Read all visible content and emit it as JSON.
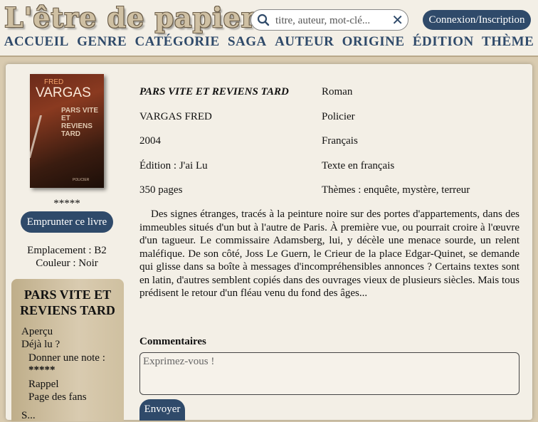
{
  "header": {
    "logo_text": "L'être de papier",
    "search": {
      "placeholder": "titre, auteur, mot-clé..."
    },
    "login_label": "Connexion/Inscription",
    "nav": [
      "ACCUEIL",
      "GENRE",
      "CATÉGORIE",
      "SAGA",
      "AUTEUR",
      "ORIGINE",
      "ÉDITION",
      "THÈME"
    ]
  },
  "book": {
    "cover": {
      "author": "FRED",
      "author_last": "VARGAS",
      "title_lines": "PARS VITE ET REVIENS TARD",
      "publisher": "POLICIER"
    },
    "rating": "*****",
    "borrow_label": "Emprunter ce livre",
    "location": "Emplacement : B2",
    "color": "Couleur : Noir",
    "title": "PARS VITE ET REVIENS TARD",
    "author": "VARGAS FRED",
    "year": "2004",
    "edition": "Édition : J'ai Lu",
    "pages": "350 pages",
    "genre": "Roman",
    "category": "Policier",
    "origin": "Français",
    "language": "Texte en français",
    "themes": "Thèmes : enquête, mystère, terreur",
    "description": "Des signes étranges, tracés à la peinture noire sur des portes d'appartements, dans des immeubles situés d'un but à l'autre de Paris. À première vue, ou pourrait croire à l'œuvre d'un tagueur. Le commissaire Adamsberg, lui, y décèle une menace sourde, un relent maléfique. De son côté, Joss Le Guern, le Crieur de la place Edgar-Quinet, se demande qui glisse dans sa boîte à messages d'incompréhensibles annonces ? Certains textes sont en latin, d'autres semblent copiés dans des ouvrages vieux de plusieurs siècles. Mais tous prédisent le retour d'un fléau venu du fond des âges..."
  },
  "sidebar": {
    "title": "PARS VITE ET REVIENS TARD",
    "apercu": "Aperçu",
    "deja_lu": "Déjà lu ?",
    "donner_note": "Donner une note :",
    "note_stars": "*****",
    "rappel": "Rappel",
    "page_fans": "Page des fans",
    "cut_item": "S..."
  },
  "comments": {
    "label": "Commentaires",
    "placeholder": "Exprimez-vous !",
    "send_label": "Envoyer"
  }
}
